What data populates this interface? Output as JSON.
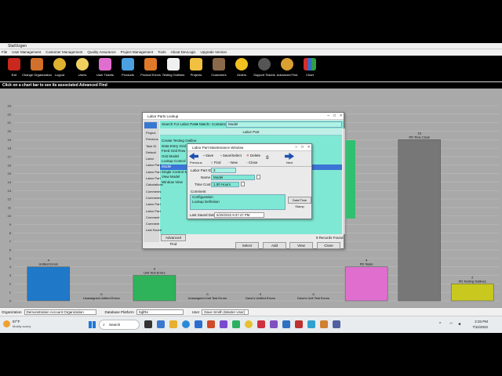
{
  "app": {
    "title": "StatVizgen",
    "menu": [
      "File",
      "User Management",
      "Customer Management",
      "Quality Assurance",
      "Project Management",
      "Tools",
      "About DevLogix",
      "Upgrade Version"
    ],
    "toolbar": [
      "Exit",
      "Change Organization",
      "Logout",
      "Users",
      "User Tickets",
      "Products",
      "Product Errors",
      "Testing Outlines",
      "Projects",
      "Customers",
      "Orders",
      "Support Tickets",
      "Advanced Find",
      "Chart"
    ],
    "hint": "Click on a chart bar to see its associated Advanced Find"
  },
  "chart_data": {
    "type": "bar",
    "title": "",
    "ylim": [
      0,
      23
    ],
    "yticks": [
      "0",
      "1",
      "2",
      "3",
      "4",
      "5",
      "6",
      "7",
      "8",
      "9",
      "10",
      "11",
      "12",
      "13",
      "14",
      "15",
      "16",
      "17",
      "18",
      "19",
      "20",
      "21",
      "22",
      "23"
    ],
    "categories": [
      "Unified Errors",
      "Unassigned Unified Errors",
      "Unit Test Errors",
      "Unassigned Unit Test Errors",
      "Dave's Unified Errors",
      "Dave's Unit Test Errors",
      "PD Tasks",
      "PD Time Clock",
      "PD Testing Outlines"
    ],
    "values": [
      4,
      0,
      3,
      0,
      0,
      0,
      4,
      19,
      2
    ],
    "colors": [
      "#1f78c8",
      "#1f78c8",
      "#2fb35a",
      "#2fb35a",
      "#1f78c8",
      "#2fb35a",
      "#e06ecf",
      "#777777",
      "#c8c81e"
    ]
  },
  "statusbar": {
    "org_label": "Organization",
    "org_value": "Demonstration Account Organization",
    "db_label": "Database Platform",
    "db_value": "SqlRe",
    "user_label": "User",
    "user_value": "Dave Smith (Master User)"
  },
  "lookup_window": {
    "title": "Labor Parts Lookup",
    "search_label": "Search For Labor Part",
    "match_label": "Match",
    "contains_label": "Contains",
    "search_value": "Model",
    "column_header": "Labor Part",
    "items": [
      "Create Testing Outline",
      "Data Entry Grid Columns",
      "Feed Grid Row",
      "Grid Model",
      "Lookup Control",
      "Model",
      "Single Control Model",
      "View Model",
      "Window View"
    ],
    "selected_index": 5,
    "advanced_find": "Advanced Find",
    "records_found": "9 Records Found",
    "buttons": [
      "Select",
      "Add",
      "View",
      "Close"
    ],
    "left_labels": [
      "Project",
      "Previous",
      "Task ID",
      "Default",
      "Labor",
      "Labor Part",
      "Labor Part",
      "Labor Part",
      "Calculations",
      "Comments",
      "Comments",
      "Labor Part",
      "Labor Part",
      "Comment",
      "Comment",
      "Last Saved"
    ]
  },
  "maint_window": {
    "title": "Labor Part Maintenance Window",
    "toolbar": [
      "Save",
      "Save/Select",
      "Delete",
      "Next",
      "Previous",
      "Find",
      "New",
      "Close"
    ],
    "id_label": "Labor Part ID",
    "id_value": "3",
    "name_label": "Name",
    "name_value": "Model",
    "time_label": "Time Cost",
    "time_value": "1.00 Hours",
    "comment_label": "Comment",
    "comment_lines": [
      "Configuration",
      "Lookup Definition"
    ],
    "date_stamp_button": "Date/Time Stamp",
    "last_saved_label": "Last Saved Date",
    "last_saved_value": "6/20/2022 9:37:47 PM"
  },
  "taskbar": {
    "weather_temp": "87°F",
    "weather_desc": "Mostly sunny",
    "search_label": "Search",
    "time": "2:33 PM",
    "date": "7/11/2022"
  }
}
